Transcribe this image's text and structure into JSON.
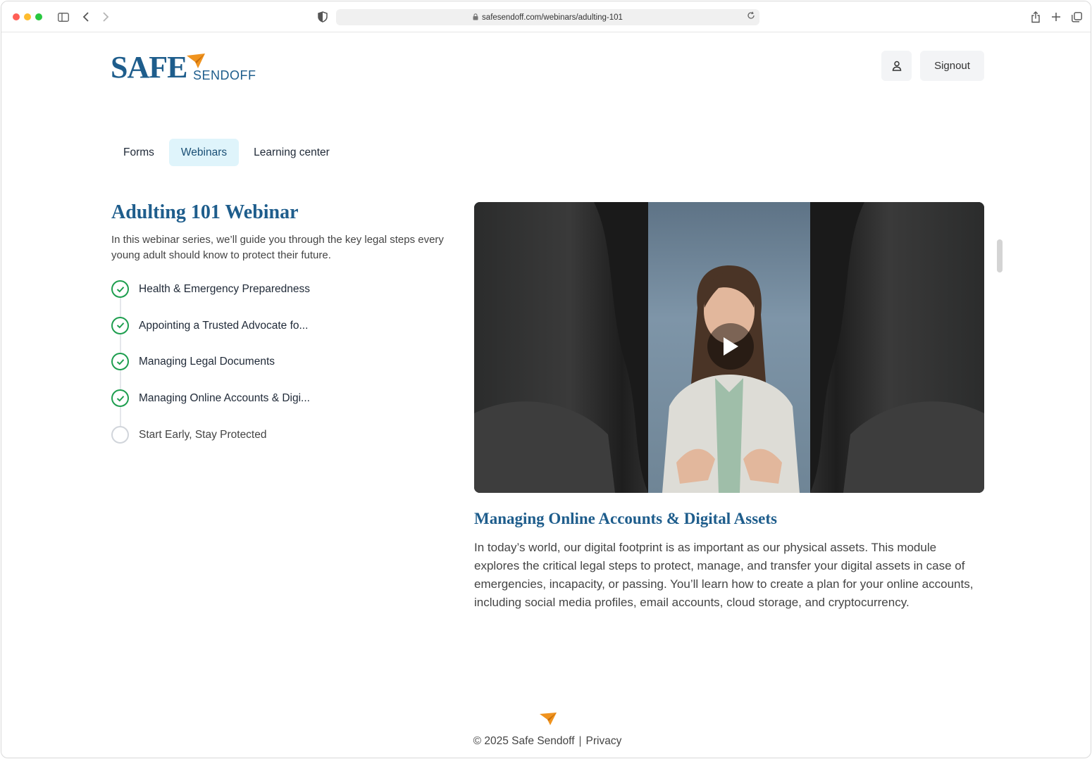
{
  "browser": {
    "url": "safesendoff.com/webinars/adulting-101",
    "icons": [
      "sidebar-icon",
      "back-icon",
      "forward-icon",
      "shield-icon",
      "lock-icon",
      "reload-icon",
      "share-icon",
      "plus-icon",
      "tabs-icon"
    ]
  },
  "header": {
    "logo_text_primary": "SAFE",
    "logo_text_secondary": "SENDOFF",
    "signout_label": "Signout"
  },
  "nav": {
    "tabs": [
      {
        "label": "Forms",
        "active": false
      },
      {
        "label": "Webinars",
        "active": true
      },
      {
        "label": "Learning center",
        "active": false
      }
    ]
  },
  "webinar": {
    "title": "Adulting 101 Webinar",
    "intro": "In this webinar series, we’ll guide you through the key legal steps every young adult should know to protect their future.",
    "modules": [
      {
        "label": "Health & Emergency Preparedness",
        "completed": true
      },
      {
        "label": "Appointing a Trusted Advocate fo...",
        "completed": true
      },
      {
        "label": "Managing Legal Documents",
        "completed": true
      },
      {
        "label": "Managing Online Accounts & Digi...",
        "completed": true
      },
      {
        "label": "Start Early, Stay Protected",
        "completed": false
      }
    ]
  },
  "current_module": {
    "title": "Managing Online Accounts & Digital Assets",
    "description": "In today’s world, our digital footprint is as important as our physical assets. This module explores the critical legal steps to protect, manage, and transfer your digital assets in case of emergencies, incapacity, or passing. You’ll learn how to create a plan for your online accounts, including social media profiles, email accounts, cloud storage, and cryptocurrency."
  },
  "footer": {
    "copyright": "© 2025 Safe Sendoff",
    "separator": "|",
    "privacy_label": "Privacy"
  },
  "colors": {
    "brand_blue": "#1e5d8c",
    "brand_orange": "#f0931e",
    "check_green": "#1e9e4f",
    "active_tab_bg": "#dff4fb"
  }
}
